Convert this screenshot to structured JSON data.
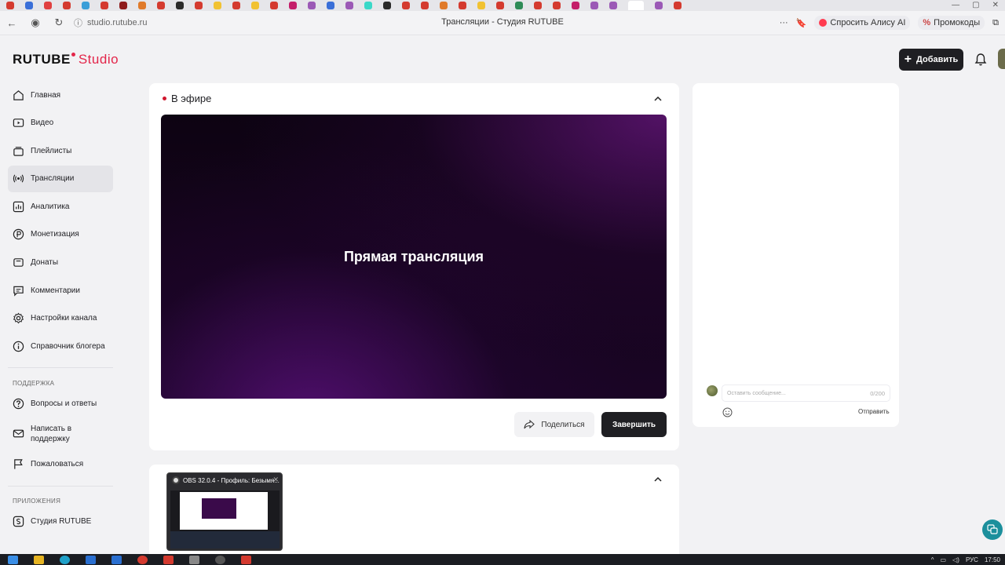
{
  "browser": {
    "url": "studio.rutube.ru",
    "page_title": "Трансляции - Студия RUTUBE",
    "alice_label": "Спросить Алису AI",
    "promo_label": "Промокоды",
    "tab_colors": [
      "#d43a2f",
      "#3a6fd8",
      "#e04040",
      "#d43a2f",
      "#3a9ed8",
      "#d43a2f",
      "#8e1b1b",
      "#e07a2a",
      "#d43a2f",
      "#2a2a2a",
      "#d43a2f",
      "#f1c232",
      "#d43a2f",
      "#f1c232",
      "#d43a2f",
      "#c41e6a",
      "#9b59b6",
      "#3a6fd8",
      "#9b59b6",
      "#3ad8c8",
      "#2a2a2a",
      "#d43a2f",
      "#d43a2f",
      "#e07a2a",
      "#d43a2f",
      "#f1c232",
      "#d43a2f",
      "#2e8b57",
      "#d43a2f",
      "#d43a2f",
      "#c41e6a",
      "#9b59b6",
      "#9b59b6",
      "#9b59b6",
      "#d43a2f"
    ]
  },
  "header": {
    "logo_text": "RUTUBE",
    "logo_studio": "Studio",
    "add_label": "Добавить",
    "brand_color": "#e3264a"
  },
  "sidebar": {
    "items": [
      {
        "label": "Главная",
        "icon": "home-icon"
      },
      {
        "label": "Видео",
        "icon": "video-icon"
      },
      {
        "label": "Плейлисты",
        "icon": "playlist-icon"
      },
      {
        "label": "Трансляции",
        "icon": "broadcast-icon",
        "active": true
      },
      {
        "label": "Аналитика",
        "icon": "analytics-icon"
      },
      {
        "label": "Монетизация",
        "icon": "monetization-icon"
      },
      {
        "label": "Донаты",
        "icon": "donate-icon"
      },
      {
        "label": "Комментарии",
        "icon": "comment-icon"
      },
      {
        "label": "Настройки канала",
        "icon": "settings-icon"
      },
      {
        "label": "Справочник блогера",
        "icon": "info-icon"
      }
    ],
    "support_section": "ПОДДЕРЖКА",
    "support_items": [
      {
        "label": "Вопросы и ответы",
        "icon": "question-icon"
      },
      {
        "label_line1": "Написать в",
        "label_line2": "поддержку",
        "icon": "mail-icon"
      },
      {
        "label": "Пожаловаться",
        "icon": "flag-icon"
      }
    ],
    "apps_section": "ПРИЛОЖЕНИЯ",
    "apps_items": [
      {
        "label": "Студия RUTUBE",
        "icon": "studio-app-icon"
      }
    ]
  },
  "live": {
    "status_label": "В эфире",
    "player_text": "Прямая трансляция",
    "share_label": "Поделиться",
    "end_label": "Завершить"
  },
  "chat": {
    "placeholder": "Оставить сообщение...",
    "counter": "0/200",
    "send_label": "Отправить"
  },
  "obs_popup": {
    "title": "OBS 32.0.4 - Профиль: Безымя..."
  },
  "taskbar": {
    "language": "РУС",
    "time": "17:50"
  }
}
